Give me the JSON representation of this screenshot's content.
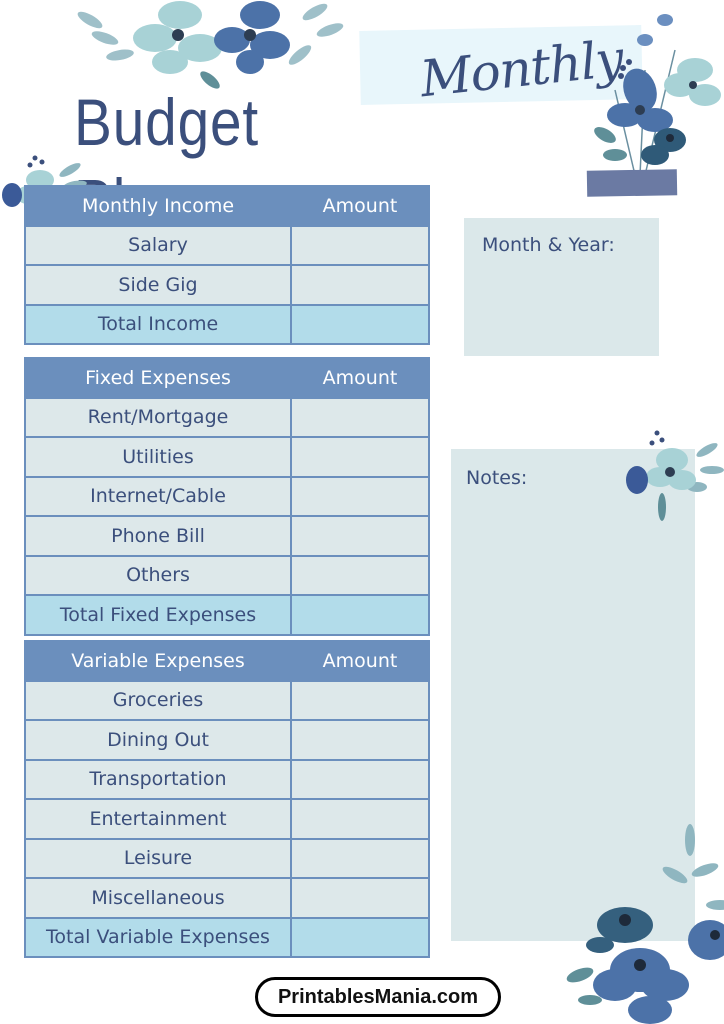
{
  "header": {
    "script_title": "Monthly",
    "title": "Budget Planner"
  },
  "colors": {
    "header_fill": "#6b8fbd",
    "row_fill": "#dde8ea",
    "total_fill": "#b2dcea",
    "text": "#3b4f7c",
    "box_fill": "#dbe8ea"
  },
  "income_table": {
    "header_label": "Monthly Income",
    "header_amount": "Amount",
    "rows": [
      {
        "label": "Salary",
        "amount": ""
      },
      {
        "label": "Side Gig",
        "amount": ""
      }
    ],
    "total": {
      "label": "Total Income",
      "amount": ""
    }
  },
  "fixed_table": {
    "header_label": "Fixed Expenses",
    "header_amount": "Amount",
    "rows": [
      {
        "label": "Rent/Mortgage",
        "amount": ""
      },
      {
        "label": "Utilities",
        "amount": ""
      },
      {
        "label": "Internet/Cable",
        "amount": ""
      },
      {
        "label": "Phone Bill",
        "amount": ""
      },
      {
        "label": "Others",
        "amount": ""
      }
    ],
    "total": {
      "label": "Total Fixed Expenses",
      "amount": ""
    }
  },
  "variable_table": {
    "header_label": "Variable Expenses",
    "header_amount": "Amount",
    "rows": [
      {
        "label": "Groceries",
        "amount": ""
      },
      {
        "label": "Dining Out",
        "amount": ""
      },
      {
        "label": "Transportation",
        "amount": ""
      },
      {
        "label": "Entertainment",
        "amount": ""
      },
      {
        "label": "Leisure",
        "amount": ""
      },
      {
        "label": "Miscellaneous",
        "amount": ""
      }
    ],
    "total": {
      "label": "Total Variable Expenses",
      "amount": ""
    }
  },
  "side": {
    "month_year_label": "Month & Year:",
    "notes_label": "Notes:"
  },
  "footer": {
    "brand": "PrintablesMania.com"
  },
  "decorations": {
    "icons": [
      "floral-watercolor-icon",
      "tape-strip"
    ]
  }
}
